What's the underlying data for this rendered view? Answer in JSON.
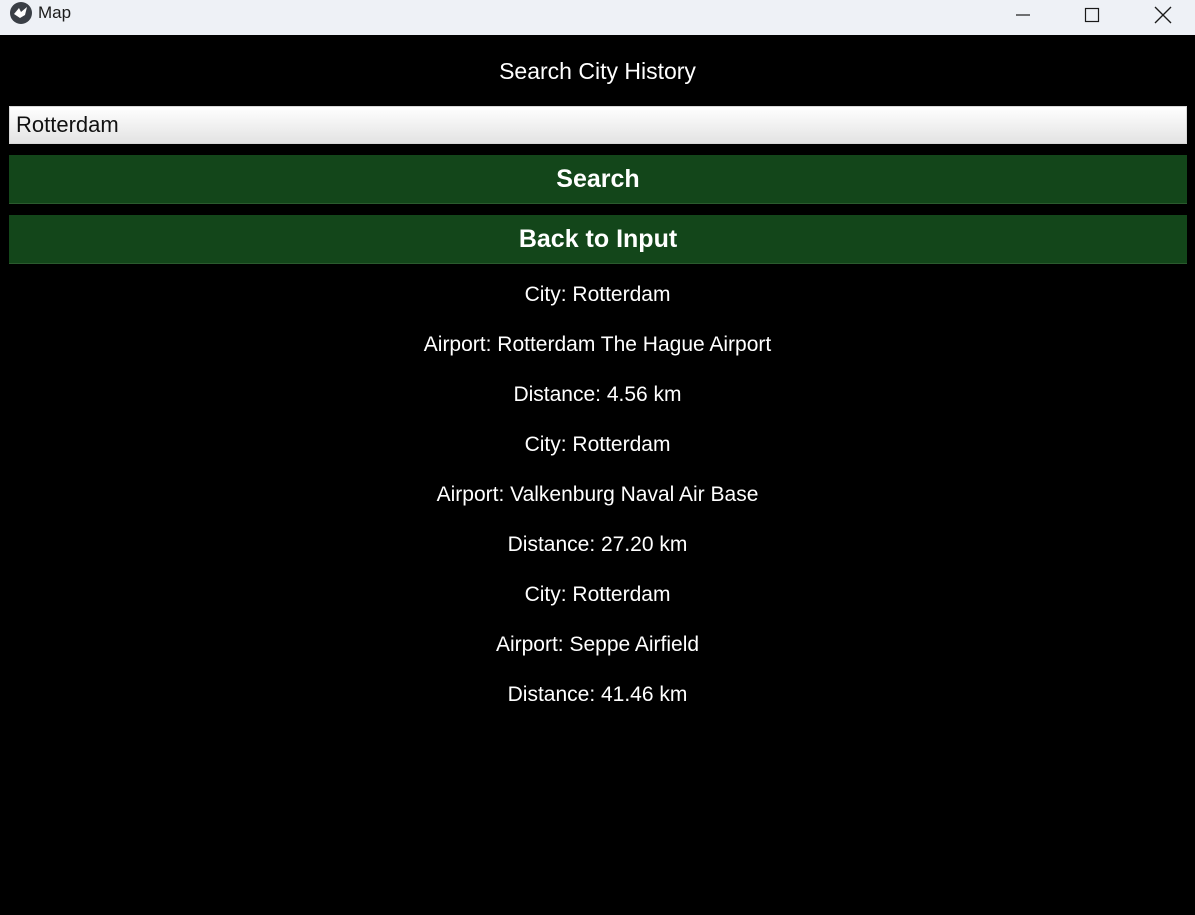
{
  "window": {
    "title": "Map",
    "icon": "kivy-logo-icon",
    "controls": [
      "minimize-icon",
      "maximize-icon",
      "close-icon"
    ]
  },
  "page": {
    "title": "Search City History"
  },
  "search": {
    "value": "Rotterdam",
    "placeholder": ""
  },
  "buttons": {
    "search_label": "Search",
    "back_label": "Back to Input"
  },
  "results": [
    "City: Rotterdam",
    "Airport: Rotterdam The Hague Airport",
    "Distance: 4.56 km",
    "City: Rotterdam",
    "Airport: Valkenburg Naval Air Base",
    "Distance: 27.20 km",
    "City: Rotterdam",
    "Airport: Seppe Airfield",
    "Distance: 41.46 km"
  ],
  "colors": {
    "background": "#000000",
    "button": "#13461a",
    "text": "#ffffff",
    "titlebar": "#eef1f6"
  }
}
